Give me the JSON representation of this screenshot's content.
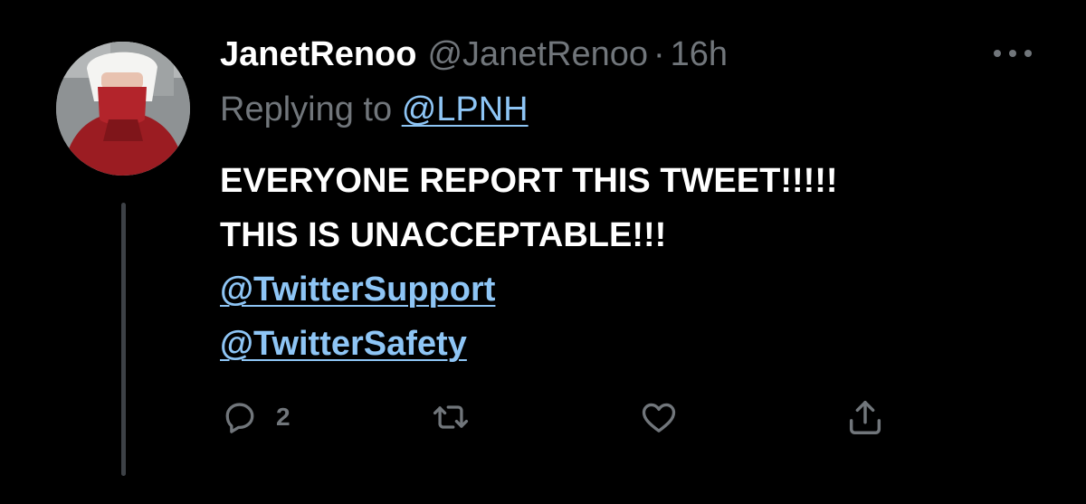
{
  "tweet": {
    "display_name": "JanetRenoo",
    "handle": "@JanetRenoo",
    "separator": "·",
    "time": "16h",
    "more_icon": "ellipsis-icon",
    "replying_prefix": "Replying to",
    "replying_to": "@LPNH",
    "text_lines": [
      "EVERYONE REPORT THIS TWEET!!!!!",
      "THIS IS UNACCEPTABLE!!!"
    ],
    "mentions": [
      "@TwitterSupport",
      "@TwitterSafety"
    ]
  },
  "actions": {
    "reply_icon": "reply-icon",
    "reply_count": "2",
    "retweet_icon": "retweet-icon",
    "like_icon": "heart-icon",
    "share_icon": "share-icon"
  },
  "colors": {
    "background": "#000000",
    "primary_text": "#ffffff",
    "secondary_text": "#71767b",
    "link": "#8ec5f5",
    "thread_line": "#3d4146"
  }
}
